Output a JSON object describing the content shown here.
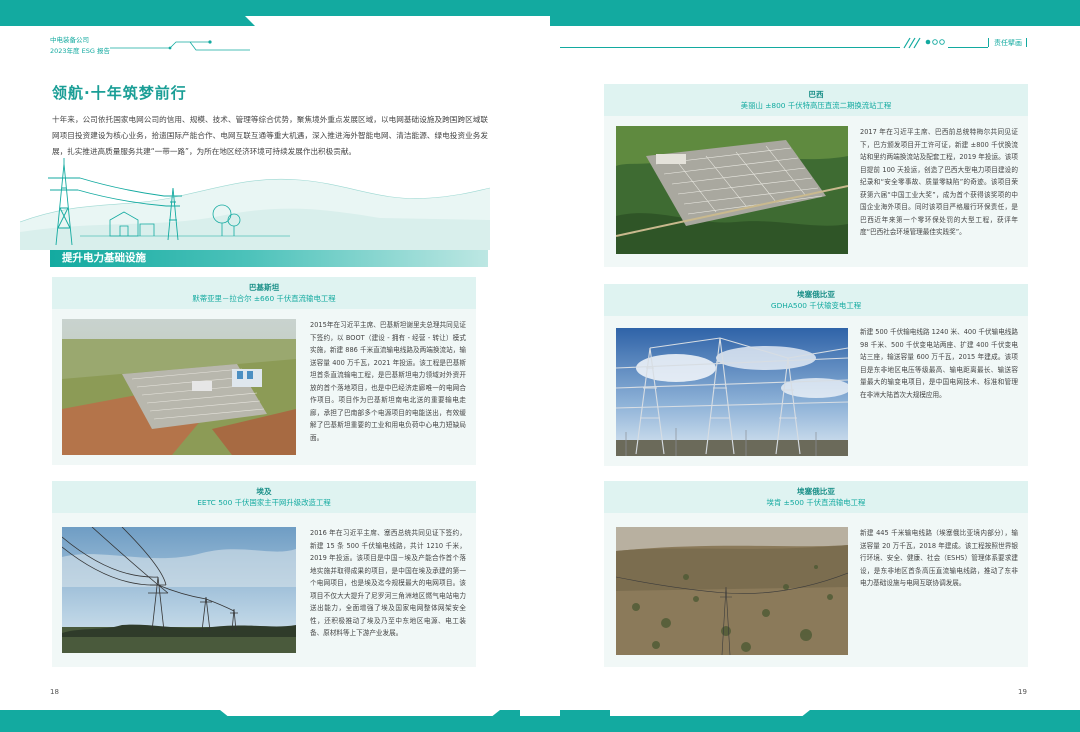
{
  "header": {
    "company": "中电装备公司",
    "report": "2023年度 ESG 报告",
    "section_tag": "责任擘画"
  },
  "left_page": {
    "title": "领航·十年筑梦前行",
    "intro": "十年来，公司依托国家电网公司的信用、规模、技术、管理等综合优势，聚焦境外重点发展区域，以电网基础设施及跨国跨区域联网项目投资建设为核心业务，拾遗国际产能合作、电网互联互通等重大机遇，深入推进海外智能电网、清洁能源、绿电投资业务发展，扎实推进高质量服务共建“一带一路”，为所在地区经济环境可持续发展作出积极贡献。",
    "section_title": "提升电力基础设施",
    "page_number": "18"
  },
  "right_page": {
    "page_number": "19"
  },
  "cards": [
    {
      "country": "巴基斯坦",
      "project": "默蒂亚里－拉合尔 ±660 千伏直流输电工程",
      "text": "2015年在习近平主席、巴基斯坦谢里夫总理共同见证下签约，以 BOOT（建设 - 拥有 - 经营 - 转让）模式实施，新建 886 千米直流输电线路及两端换流站，输送容量 400 万千瓦，2021 年投运。该工程是巴基斯坦首条直流输电工程，是巴基斯坦电力领域对外资开放的首个落地项目，也是中巴经济走廊唯一的电网合作项目。项目作为巴基斯坦南电北送的重要输电走廊，承担了巴南部多个电源项目的电能送出，有效缓解了巴基斯坦重要的工业和用电负荷中心电力短缺局面。"
    },
    {
      "country": "埃及",
      "project": "EETC 500 千伏国家主干网升级改造工程",
      "text": "2016 年在习近平主席、塞西总统共同见证下签约，新建 15 条 500 千伏输电线路，共计 1210 千米，2019 年投运。该项目是中国－埃及产能合作首个落地实施并取得成果的项目，是中国在埃及承建的第一个电网项目，也是埃及迄今规模最大的电网项目。该项目不仅大大提升了尼罗河三角洲地区燃气电站电力送出能力，全面增强了埃及国家电网整体网架安全性，还积极推动了埃及乃至中东地区电源、电工装备、原材料等上下游产业发展。"
    },
    {
      "country": "巴西",
      "project": "美丽山 ±800 千伏特高压直流二期换流站工程",
      "text": "2017 年在习近平主席、巴西前总统特梅尔共同见证下，巴方颁发项目开工许可证，新建 ±800 千伏换流站和里约两端换流站及配套工程，2019 年投运。该项目提前 100 天投运，创造了巴西大型电力项目建设的纪录和“安全零事故、质量零缺陷”的奇迹。该项目荣获第六届“中国工业大奖”，成为首个获得该奖项的中国企业海外项目。同时该项目严格履行环保责任，是巴西近年来第一个零环保处罚的大型工程，获评年度“巴西社会环境管理最佳实践奖”。"
    },
    {
      "country": "埃塞俄比亚",
      "project": "GDHA500 千伏输变电工程",
      "text": "新建 500 千伏输电线路 1240 米、400 千伏输电线路 98 千米、500 千伏变电站两座、扩建 400 千伏变电站三座，输送容量 600 万千瓦，2015 年建成。该项目是东非地区电压等级最高、输电距离最长、输送容量最大的输变电项目，是中国电网技术、标准和管理在非洲大陆首次大规模应用。"
    },
    {
      "country": "埃塞俄比亚",
      "project": "埃肯 ±500 千伏直流输电工程",
      "text": "新建 445 千米输电线路（埃塞俄比亚境内部分），输送容量 20 万千瓦，2018 年建成。该工程按照世界银行环境、安全、健康、社会（ESHS）管理体系要求建设，是东非地区首条高压直流输电线路，推动了东非电力基础设施与电网互联协调发展。"
    }
  ],
  "colors": {
    "accent": "#13aaa0",
    "card_bg": "#f1f8f7",
    "card_head_bg": "#dff3f1"
  }
}
